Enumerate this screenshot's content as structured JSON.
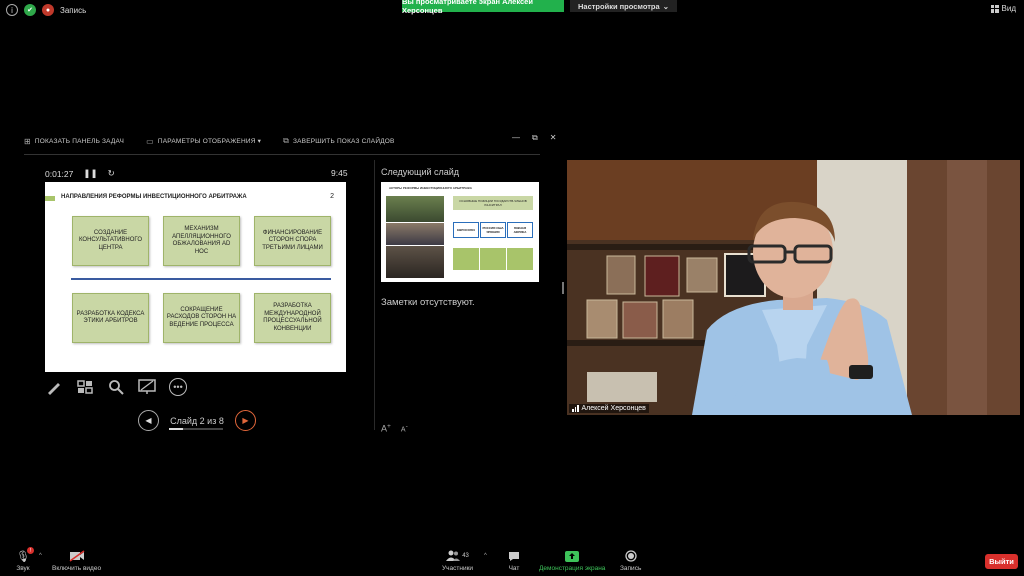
{
  "topbar": {
    "record_label": "Запись",
    "share_banner": "Вы просматриваете экран Алексей Херсонцев",
    "view_settings": "Настройки просмотра",
    "view_label": "Вид"
  },
  "presenter": {
    "toolbar": {
      "taskbar": "ПОКАЗАТЬ ПАНЕЛЬ ЗАДАЧ",
      "display_settings": "ПАРАМЕТРЫ ОТОБРАЖЕНИЯ ▾",
      "end_show": "ЗАВЕРШИТЬ ПОКАЗ СЛАЙДОВ"
    },
    "elapsed": "0:01:27",
    "clock": "9:45",
    "current_slide": {
      "title": "НАПРАВЛЕНИЯ РЕФОРМЫ ИНВЕСТИЦИОННОГО АРБИТРАЖА",
      "number": "2",
      "boxes": [
        "СОЗДАНИЕ КОНСУЛЬТАТИВНОГО ЦЕНТРА",
        "МЕХАНИЗМ АПЕЛЛЯЦИОННОГО ОБЖАЛОВАНИЯ AD HOC",
        "ФИНАНСИРОВАНИЕ СТОРОН СПОРА ТРЕТЬИМИ ЛИЦАМИ",
        "РАЗРАБОТКА КОДЕКСА ЭТИКИ АРБИТРОВ",
        "СОКРАЩЕНИЕ РАСХОДОВ СТОРОН НА ВЕДЕНИЕ ПРОЦЕССА",
        "РАЗРАБОТКА МЕЖДУНАРОДНОЙ ПРОЦЕССУАЛЬНОЙ КОНВЕНЦИИ"
      ]
    },
    "slide_counter": "Слайд 2 из 8",
    "slide_progress": 0.25,
    "next_label": "Следующий слайд",
    "next_slide": {
      "title": "АКТОРЫ РЕФОРМЫ ИНВЕСТИЦИОННОГО АРБИТРАЖА",
      "top_box": "ОСНОВНЫЕ ПОЗИЦИИ ГОСУДАРСТВ-ЧЛЕНОВ ЮНСИТРАЛ",
      "blue_boxes": [
        "ЕВРОСОЮЗ",
        "РОССИЯ США ЯПОНИЯ",
        "ЮЖНАЯ АФРИКА"
      ]
    },
    "notes": "Заметки отсутствуют.",
    "font_increase": "A",
    "font_decrease": "A"
  },
  "video": {
    "participant_name": "Алексей Херсонцев"
  },
  "bottombar": {
    "audio": "Звук",
    "video": "Включить видео",
    "participants": "Участники",
    "participants_count": "43",
    "chat": "Чат",
    "share": "Демонстрация экрана",
    "record": "Запись",
    "leave": "Выйти"
  },
  "colors": {
    "share_green": "#22b14c",
    "leave_red": "#d9302c",
    "slide_box_green": "#c9d7a5",
    "next_nav_orange": "#e0663a"
  }
}
